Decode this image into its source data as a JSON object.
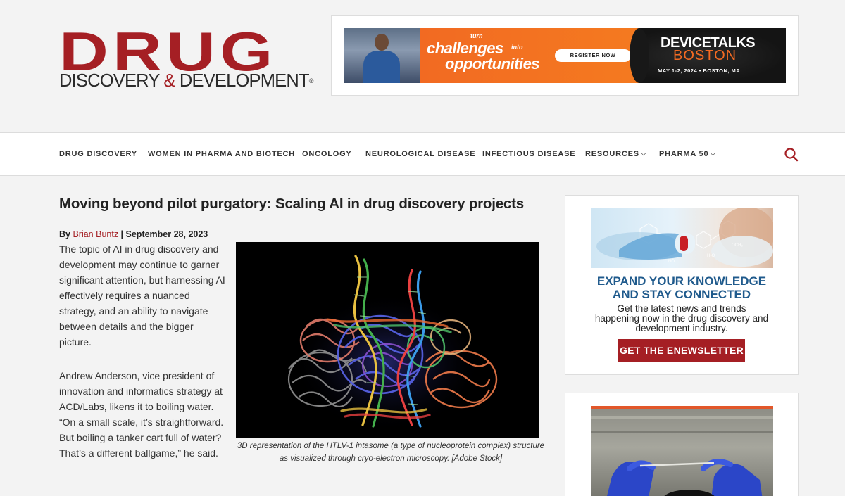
{
  "header": {
    "logo_main": "DRUG",
    "logo_sub_1": "DISCOVERY ",
    "logo_amp": "&",
    "logo_sub_2": " DEVELOPMENT",
    "logo_reg": "®",
    "ad": {
      "turn": "turn",
      "challenges": "challenges",
      "into": "into",
      "opportunities": "opportunities",
      "register": "REGISTER NOW",
      "devicetalks": "DEVICETALKS",
      "boston": "BOSTON",
      "date": "MAY 1-2, 2024  •  BOSTON, MA"
    }
  },
  "nav": {
    "items": [
      {
        "label": "DRUG DISCOVERY"
      },
      {
        "label": "WOMEN IN PHARMA AND BIOTECH"
      },
      {
        "label": "ONCOLOGY"
      },
      {
        "label": "NEUROLOGICAL DISEASE"
      },
      {
        "label": "INFECTIOUS DISEASE"
      },
      {
        "label": "RESOURCES"
      },
      {
        "label": "PHARMA 50"
      }
    ],
    "chevron": "⌵",
    "search_icon": "search-icon"
  },
  "article": {
    "title": "Moving beyond pilot purgatory: Scaling AI in drug discovery projects",
    "by": "By ",
    "author": "Brian Buntz",
    "date": " | September 28, 2023",
    "p1": "The topic of AI in drug discovery and development may continue to garner significant attention, but harnessing AI effectively requires a nuanced strategy, and an ability to navigate between details and the bigger picture.",
    "p2": "Andrew Anderson, vice president of innovation and informatics strategy at ACD/Labs, likens it to boiling water. “On a small scale, it’s straightforward. But boiling a tanker cart full of water? That’s a different ballgame,” he said.",
    "caption": "3D representation of the HTLV-1 intasome (a type of nucleoprotein complex) structure as visualized through cryo-electron microscopy. [Adobe Stock]"
  },
  "sidebar": {
    "heading_1": "EXPAND YOUR KNOWLEDGE",
    "heading_2": "AND STAY CONNECTED",
    "text_1": "Get the latest news and trends",
    "text_2": "happening now in the drug discovery and",
    "text_3": "development industry.",
    "button": "GET THE ENEWSLETTER"
  },
  "colors": {
    "brand_red": "#a51f24",
    "sidebar_blue": "#1f5a8c",
    "ad_orange": "#f26a22"
  }
}
